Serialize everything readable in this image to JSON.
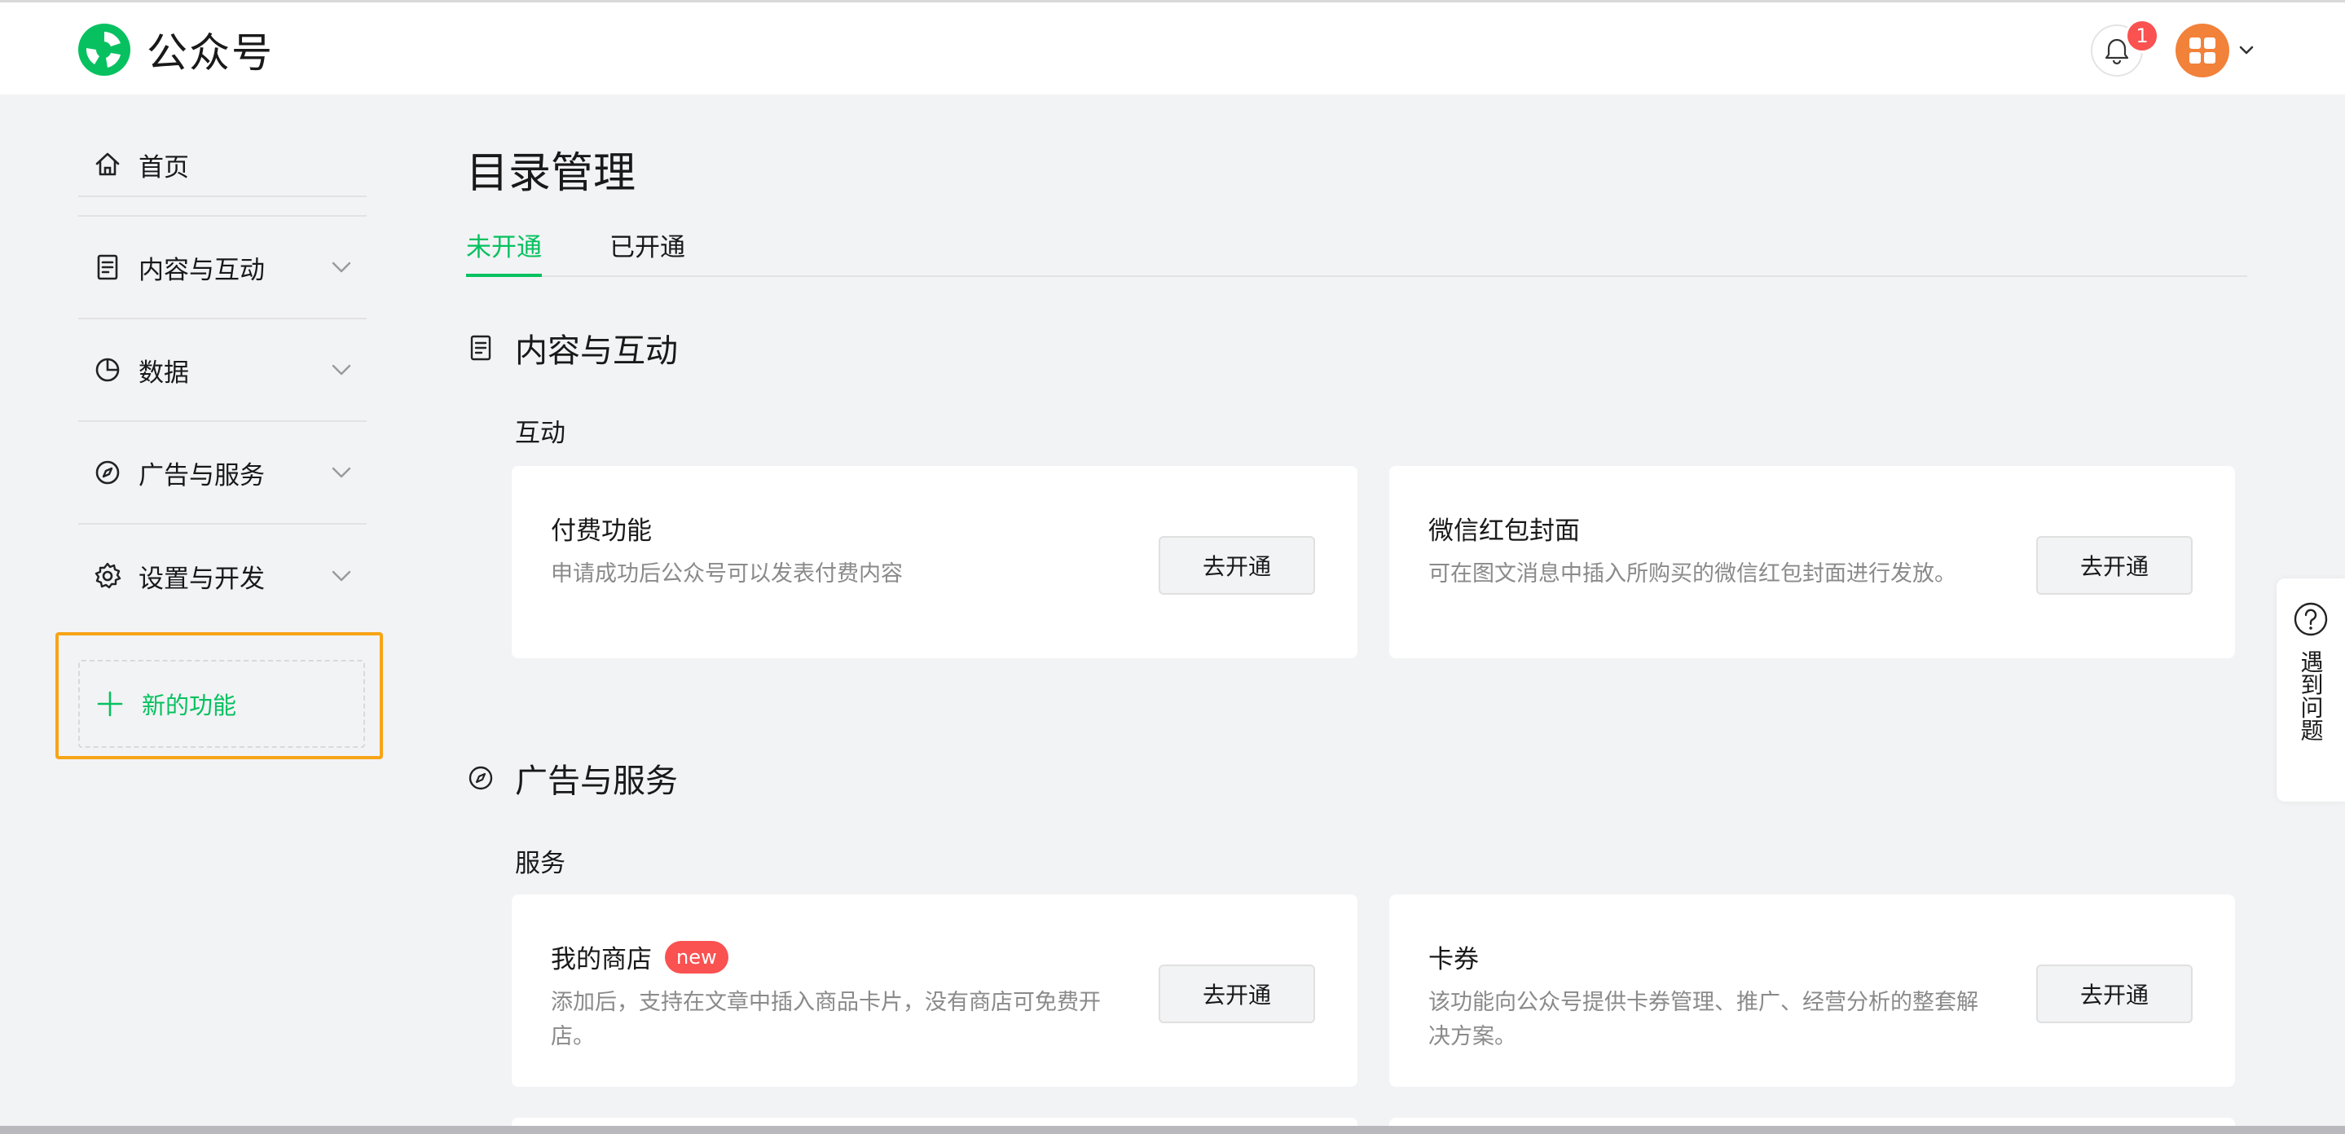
{
  "header": {
    "logo_text": "公众号",
    "notification_count": "1",
    "brand_color": "#07c160",
    "badge_color": "#fa5151",
    "avatar_color": "#f2813a"
  },
  "sidebar": {
    "items": [
      {
        "label": "首页",
        "icon": "home-icon",
        "expandable": false
      },
      {
        "label": "内容与互动",
        "icon": "document-icon",
        "expandable": true
      },
      {
        "label": "数据",
        "icon": "pie-chart-icon",
        "expandable": true
      },
      {
        "label": "广告与服务",
        "icon": "compass-icon",
        "expandable": true
      },
      {
        "label": "设置与开发",
        "icon": "gear-icon",
        "expandable": true
      }
    ],
    "new_function_label": "新的功能"
  },
  "main": {
    "title": "目录管理",
    "tabs": [
      {
        "label": "未开通",
        "active": true
      },
      {
        "label": "已开通",
        "active": false
      }
    ],
    "sections": [
      {
        "title": "内容与互动",
        "icon": "document-icon",
        "subsection": "互动",
        "cards": [
          {
            "title": "付费功能",
            "desc": "申请成功后公众号可以发表付费内容",
            "button": "去开通",
            "badge": ""
          },
          {
            "title": "微信红包封面",
            "desc": "可在图文消息中插入所购买的微信红包封面进行发放。",
            "button": "去开通",
            "badge": ""
          }
        ]
      },
      {
        "title": "广告与服务",
        "icon": "compass-icon",
        "subsection": "服务",
        "cards": [
          {
            "title": "我的商店",
            "desc": "添加后，支持在文章中插入商品卡片，没有商店可免费开店。",
            "button": "去开通",
            "badge": "new"
          },
          {
            "title": "卡券",
            "desc": "该功能向公众号提供卡券管理、推广、经营分析的整套解决方案。",
            "button": "去开通",
            "badge": ""
          }
        ]
      }
    ]
  },
  "help": {
    "label": "遇到问题"
  }
}
